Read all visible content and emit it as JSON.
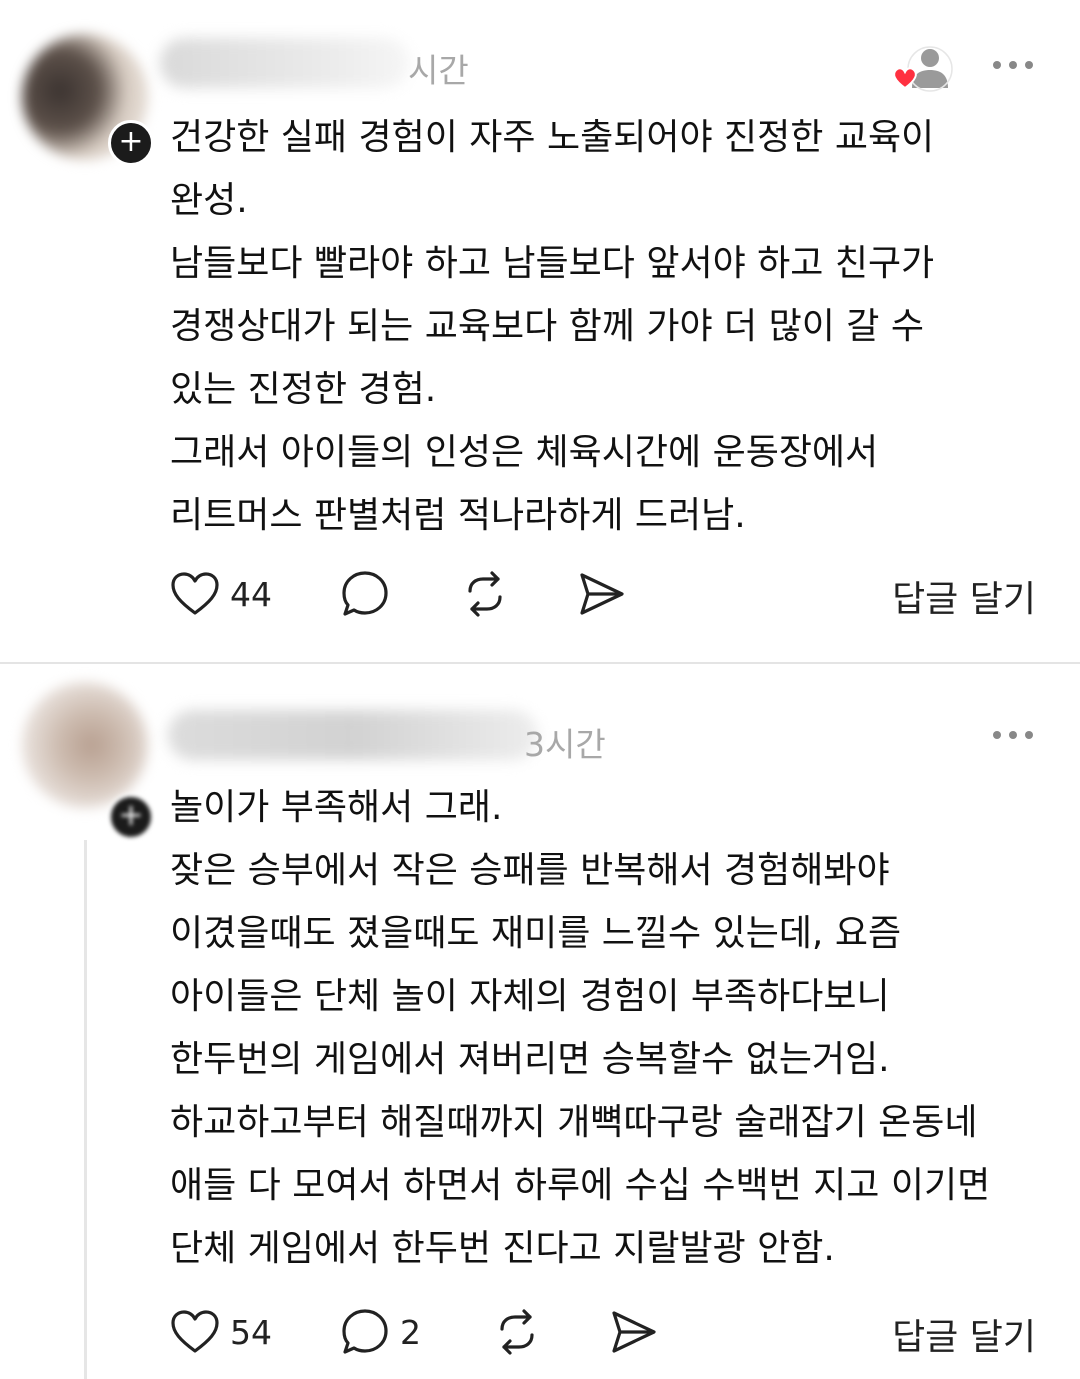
{
  "posts": [
    {
      "time": "시간",
      "body_lines": [
        "건강한 실패 경험이 자주 노출되어야 진정한 교육이",
        "완성.",
        "남들보다 빨라야 하고 남들보다 앞서야 하고 친구가",
        "경쟁상대가 되는 교육보다 함께 가야 더 많이 갈 수",
        "있는 진정한 경험.",
        "그래서 아이들의 인성은 체육시간에 운동장에서",
        "리트머스 판별처럼 적나라하게 드러남."
      ],
      "likes": "44",
      "comments": "",
      "reply_label": "답글 달기"
    },
    {
      "time": "3시간",
      "body_lines": [
        "놀이가 부족해서 그래.",
        "잦은 승부에서 작은 승패를 반복해서 경험해봐야",
        "이겼을때도 졌을때도 재미를 느낄수 있는데, 요즘",
        "아이들은 단체 놀이 자체의 경험이 부족하다보니",
        "한두번의 게임에서 져버리면 승복할수 없는거임.",
        "하교하고부터 해질때까지 개뼉따구랑 술래잡기 온동네",
        "애들 다 모여서 하면서 하루에 수십 수백번 지고 이기면",
        "단체 게임에서 한두번 진다고 지랄발광 안함."
      ],
      "likes": "54",
      "comments": "2",
      "reply_label": "답글 달기"
    }
  ],
  "icons": {
    "like": "heart-icon",
    "comment": "comment-icon",
    "repost": "repost-icon",
    "share": "send-icon",
    "more": "more-icon",
    "follow": "follow-icon",
    "liked_by_author": "heart-badge-icon"
  },
  "colors": {
    "text": "#111111",
    "meta": "#a8a8a8",
    "heart_badge": "#ff3040",
    "divider": "#e4e4e4"
  }
}
